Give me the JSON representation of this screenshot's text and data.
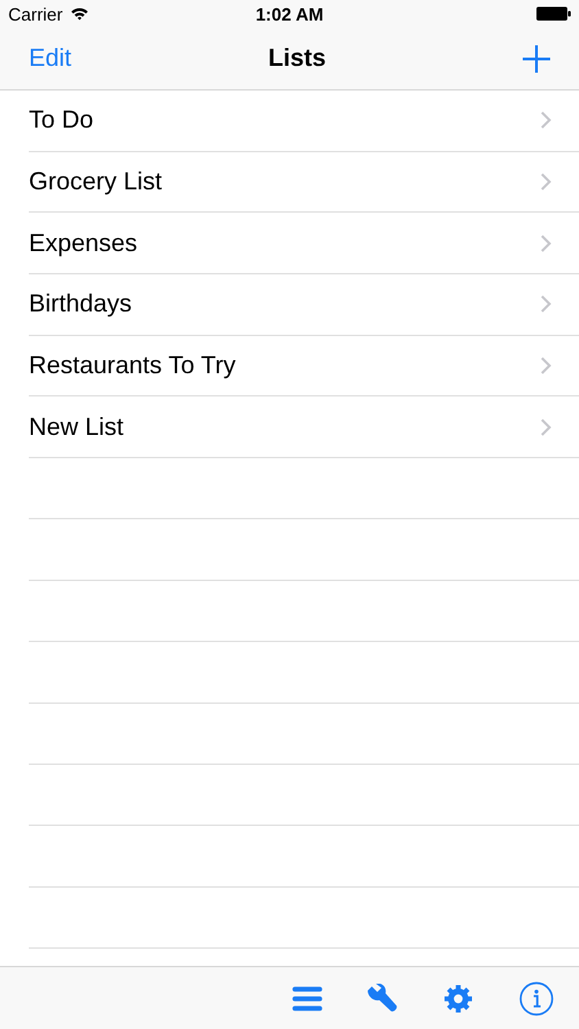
{
  "status_bar": {
    "carrier": "Carrier",
    "time": "1:02 AM"
  },
  "nav_bar": {
    "left_button": "Edit",
    "title": "Lists"
  },
  "lists": [
    {
      "name": "To Do"
    },
    {
      "name": "Grocery List"
    },
    {
      "name": "Expenses"
    },
    {
      "name": "Birthdays"
    },
    {
      "name": "Restaurants To Try"
    },
    {
      "name": "New List"
    }
  ]
}
